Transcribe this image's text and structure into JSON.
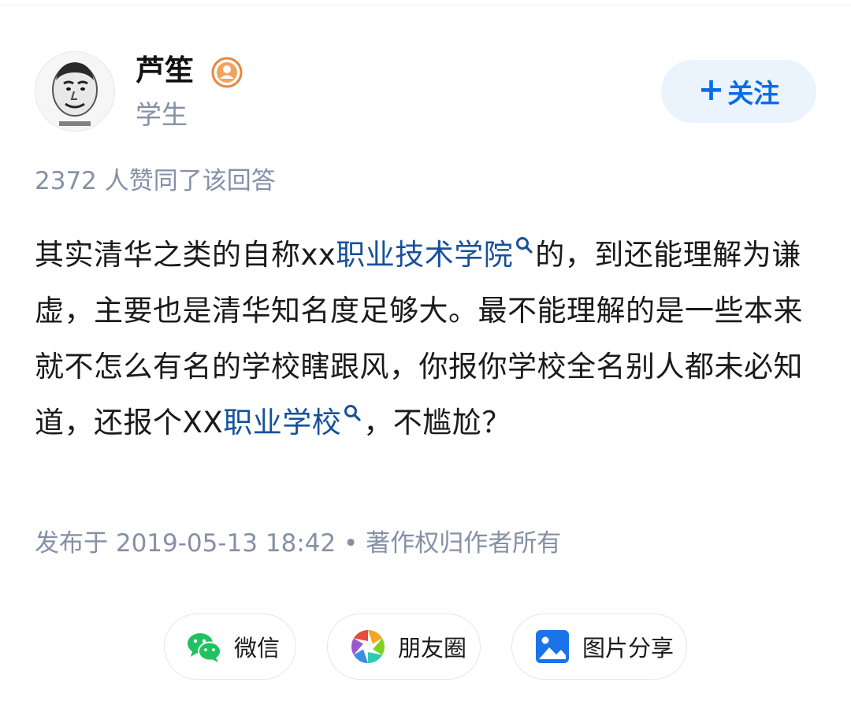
{
  "author": {
    "name": "芦笙",
    "title": "学生",
    "avatar_icon": "meme-face-avatar",
    "badge_icon": "verified-user-badge-icon"
  },
  "follow_button": {
    "plus": "+",
    "label": "关注"
  },
  "vote_line": "2372 人赞同了该回答",
  "content": {
    "p1": "其实清华之类的自称xx",
    "kw1": "职业技术学院",
    "p2": "的，到还能理解为谦虚，主要也是清华知名度足够大。最不能理解的是一些本来就不怎么有名的学校瞎跟风，你报你学校全名别人都未必知道，还报个XX",
    "kw2": "职业学校",
    "p3": "，不尴尬？"
  },
  "meta_line": "发布于 2019-05-13 18:42 • 著作权归作者所有",
  "share": {
    "wechat": "微信",
    "moments": "朋友圈",
    "image": "图片分享"
  },
  "colors": {
    "accent": "#056de8",
    "link": "#175199",
    "muted": "#8590a6",
    "badge": "#e9853c",
    "wechat_green": "#20c160"
  }
}
